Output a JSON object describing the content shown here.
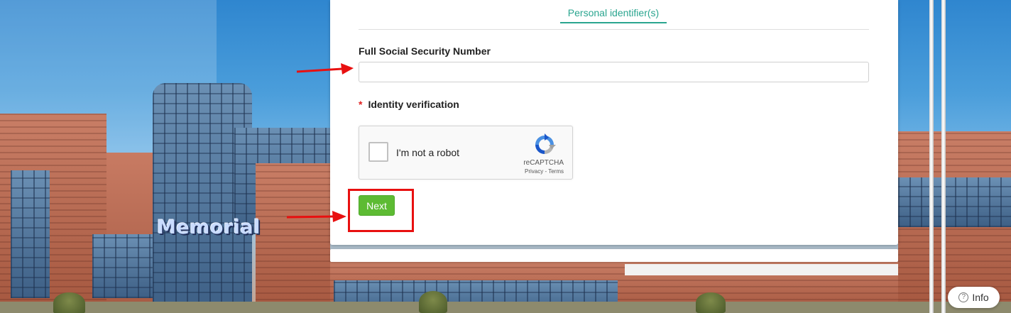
{
  "background": {
    "sign_text": "Memorial"
  },
  "form": {
    "tab_label": "Personal identifier(s)",
    "ssn_label": "Full Social Security Number",
    "ssn_value": "",
    "identity_label": "Identity verification",
    "required_marker": "*",
    "captcha": {
      "checkbox_label": "I'm not a robot",
      "brand": "reCAPTCHA",
      "links": "Privacy - Terms",
      "icon": "recaptcha-logo-icon"
    },
    "next_label": "Next"
  },
  "info_button": {
    "label": "Info",
    "icon": "question-circle-icon",
    "icon_glyph": "?"
  },
  "colors": {
    "accent": "#2aa58f",
    "next_button": "#5dbb33",
    "annotation_red": "#e81010",
    "required_red": "#e02020"
  }
}
